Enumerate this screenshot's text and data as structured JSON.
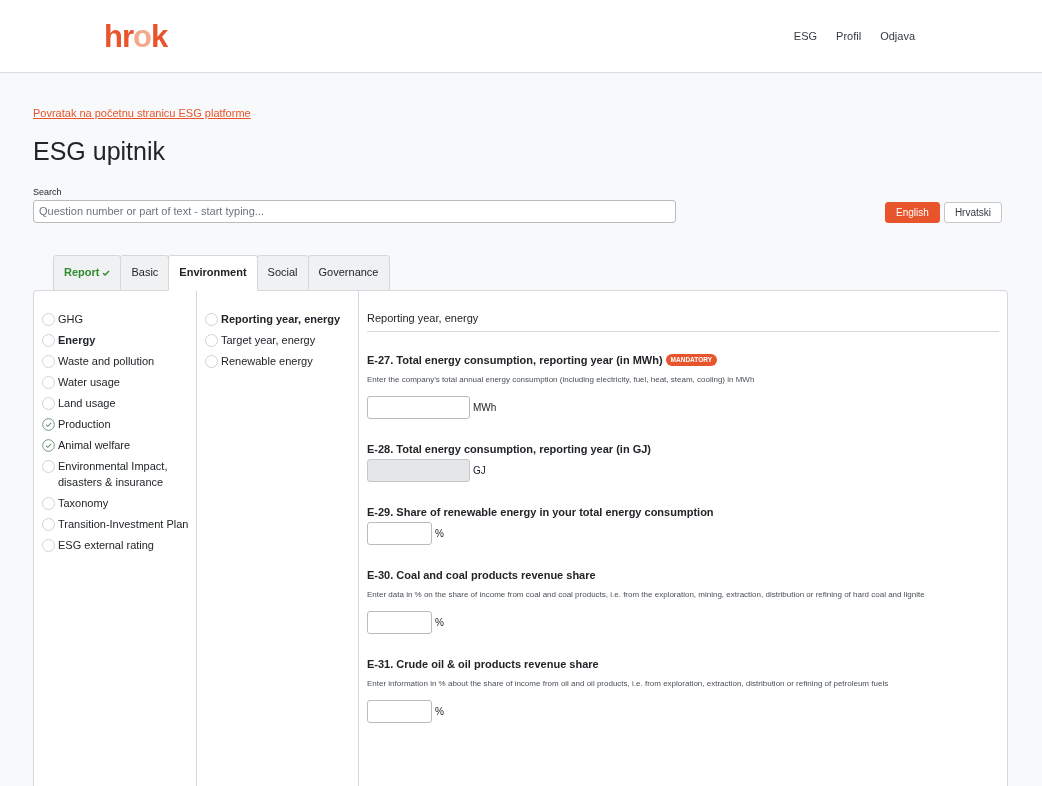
{
  "logo": "hrok",
  "nav": [
    "ESG",
    "Profil",
    "Odjava"
  ],
  "back_link": "Povratak na početnu stranicu ESG platforme",
  "title": "ESG upitnik",
  "search": {
    "label": "Search",
    "placeholder": "Question number or part of text - start typing..."
  },
  "languages": [
    {
      "label": "English",
      "selected": true
    },
    {
      "label": "Hrvatski",
      "selected": false
    }
  ],
  "tabs": [
    {
      "label": "Report",
      "selected": false,
      "done": true
    },
    {
      "label": "Basic",
      "selected": false,
      "done": false
    },
    {
      "label": "Environment",
      "selected": true,
      "done": false
    },
    {
      "label": "Social",
      "selected": false,
      "done": false
    },
    {
      "label": "Governance",
      "selected": false,
      "done": false
    }
  ],
  "categories": [
    {
      "label": "GHG",
      "selected": false,
      "done": false
    },
    {
      "label": "Energy",
      "selected": true,
      "done": false
    },
    {
      "label": "Waste and pollution",
      "selected": false,
      "done": false
    },
    {
      "label": "Water usage",
      "selected": false,
      "done": false
    },
    {
      "label": "Land usage",
      "selected": false,
      "done": false
    },
    {
      "label": "Production",
      "selected": false,
      "done": true
    },
    {
      "label": "Animal welfare",
      "selected": false,
      "done": true
    },
    {
      "label": "Environmental Impact, disasters & insurance",
      "selected": false,
      "done": false
    },
    {
      "label": "Taxonomy",
      "selected": false,
      "done": false
    },
    {
      "label": "Transition-Investment Plan",
      "selected": false,
      "done": false
    },
    {
      "label": "ESG external rating",
      "selected": false,
      "done": false
    }
  ],
  "subsections": [
    {
      "label": "Reporting year, energy",
      "selected": true,
      "done": false
    },
    {
      "label": "Target year, energy",
      "selected": false,
      "done": false
    },
    {
      "label": "Renewable energy",
      "selected": false,
      "done": false
    }
  ],
  "section_title": "Reporting year, energy",
  "questions": [
    {
      "title": "E-27. Total energy consumption, reporting year (in MWh)",
      "badge": "MANDATORY",
      "description": "Enter the company's total annual energy consumption (including electricity, fuel, heat, steam, cooling) in MWh",
      "unit": "MWh",
      "kind": "wide",
      "disabled": false
    },
    {
      "title": "E-28. Total energy consumption, reporting year (in GJ)",
      "unit": "GJ",
      "kind": "wide",
      "disabled": true
    },
    {
      "title": "E-29. Share of renewable energy in your total energy consumption",
      "unit": "%",
      "kind": "narrow",
      "disabled": false
    },
    {
      "title": "E-30. Coal and coal products revenue share",
      "description": "Enter data in % on the share of income from coal and coal products, i.e. from the exploration, mining, extraction, distribution or refining of hard coal and lignite",
      "unit": "%",
      "kind": "narrow",
      "disabled": false
    },
    {
      "title": "E-31. Crude oil & oil products revenue share",
      "description": "Enter information in % about the share of income from oil and oil products, i.e. from exploration, extraction, distribution or refining of petroleum fuels",
      "unit": "%",
      "kind": "narrow",
      "disabled": false
    }
  ]
}
